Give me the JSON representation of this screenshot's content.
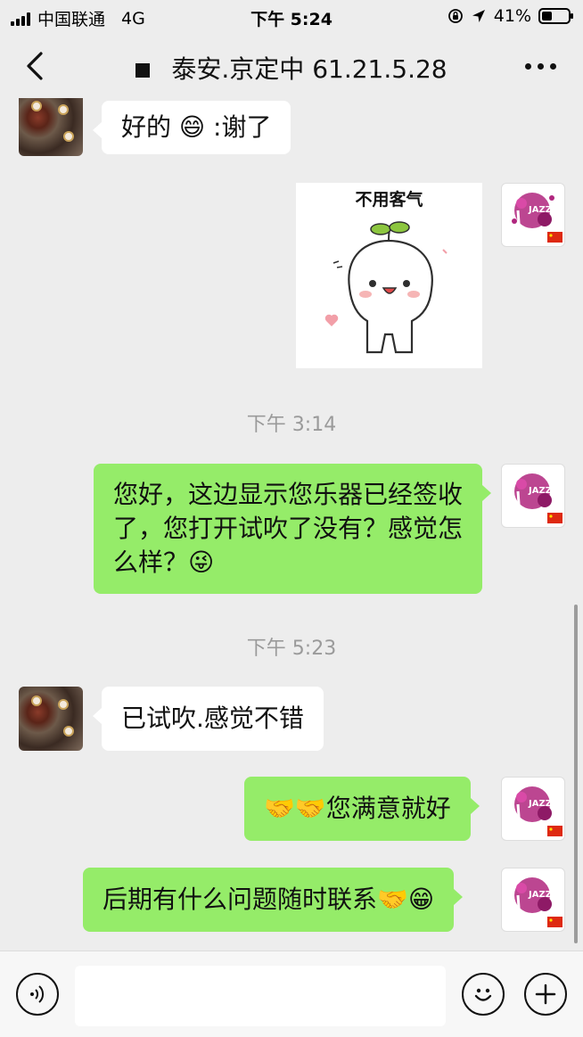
{
  "status_bar": {
    "carrier": "中国联通",
    "network": "4G",
    "time": "下午 5:24",
    "battery": "41%",
    "battery_level": 0.41
  },
  "header": {
    "title": "泰安.京定中 61.21.5.28",
    "back_icon": "chevron-left-icon",
    "more_icon": "more-dots-icon"
  },
  "messages": {
    "m1": {
      "text": "好的",
      "emoji": "😄",
      "suffix": " :谢了"
    },
    "sticker": {
      "caption": "不用客气"
    },
    "ts1": "下午 3:14",
    "m2": {
      "text": "您好，这边显示您乐器已经签收了，您打开试吹了没有？感觉怎么样？",
      "emoji": "😜"
    },
    "ts2": "下午 5:23",
    "m3": {
      "text": "已试吹.感觉不错"
    },
    "m4": {
      "emoji": "🤝🤝",
      "text": "您满意就好"
    },
    "m5": {
      "text": "后期有什么问题随时联系",
      "emoji": "🤝😁"
    }
  },
  "colors": {
    "background": "#ededed",
    "outgoing_bubble": "#95ec69",
    "incoming_bubble": "#ffffff",
    "timestamp": "#9a9a9a"
  },
  "avatar_labels": {
    "jazz": "JAZZ"
  },
  "input_bar": {
    "voice_icon": "voice-icon",
    "emoji_icon": "emoji-icon",
    "plus_icon": "plus-icon",
    "placeholder": ""
  }
}
